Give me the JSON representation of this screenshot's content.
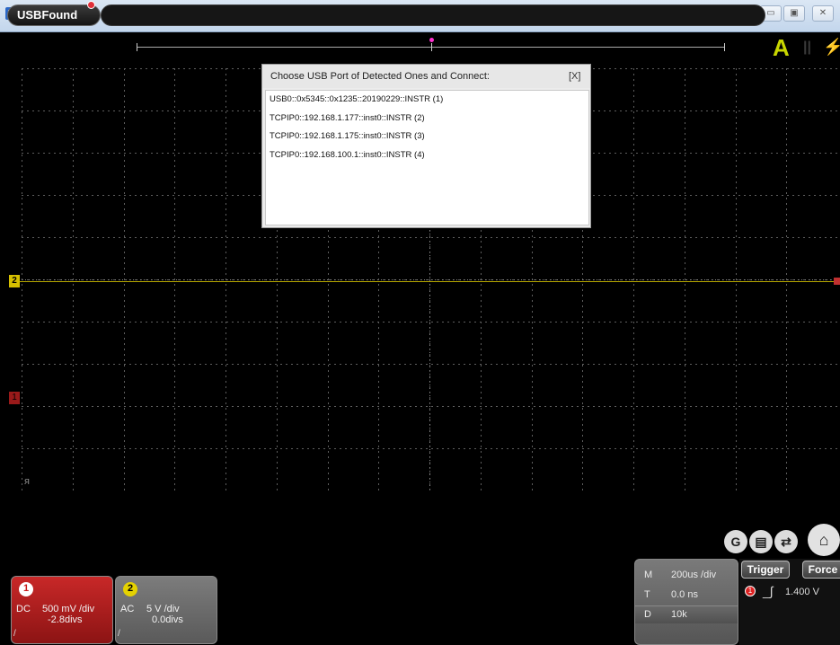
{
  "titlebar": {
    "app_icon": "PC",
    "window_buttons": [
      "▭",
      "▣",
      "✕"
    ]
  },
  "status": {
    "usb_label": "USBFound",
    "mode_letter": "A",
    "run_state": "||",
    "bolt": "⚡"
  },
  "dialog": {
    "title": "Choose USB Port of Detected Ones and Connect:",
    "close": "[X]",
    "ports": [
      "USB0::0x5345::0x1235::20190229::INSTR  (1)",
      "TCPIP0::192.168.1.177::inst0::INSTR  (2)",
      "TCPIP0::192.168.1.175::inst0::INSTR  (3)",
      "TCPIP0::192.168.100.1::inst0::INSTR  (4)"
    ]
  },
  "markers": {
    "ch2": "2",
    "ch1": "1",
    "trig_level": "ᴙ"
  },
  "channels": [
    {
      "num": "1",
      "coupling": "DC",
      "scale": "500 mV /div",
      "offset": "-2.8divs",
      "foot": "/"
    },
    {
      "num": "2",
      "coupling": "AC",
      "scale": "5 V /div",
      "offset": "0.0divs",
      "foot": "/"
    }
  ],
  "timebase": {
    "rows": [
      {
        "key": "M",
        "value": "200us /div"
      },
      {
        "key": "T",
        "value": "0.0 ns"
      },
      {
        "key": "D",
        "value": "10k"
      }
    ]
  },
  "trigger": {
    "trigger_label": "Trigger",
    "force_label": "Force",
    "source": "1",
    "edge": "_∫",
    "level": "1.400 V"
  },
  "tools": [
    "G",
    "▤",
    "⇄",
    "⌂"
  ],
  "colors": {
    "ch1": "#c82828",
    "ch2": "#e5d200",
    "grid": "#6a6a6a",
    "trigger_marker": "#ff2fd0"
  }
}
